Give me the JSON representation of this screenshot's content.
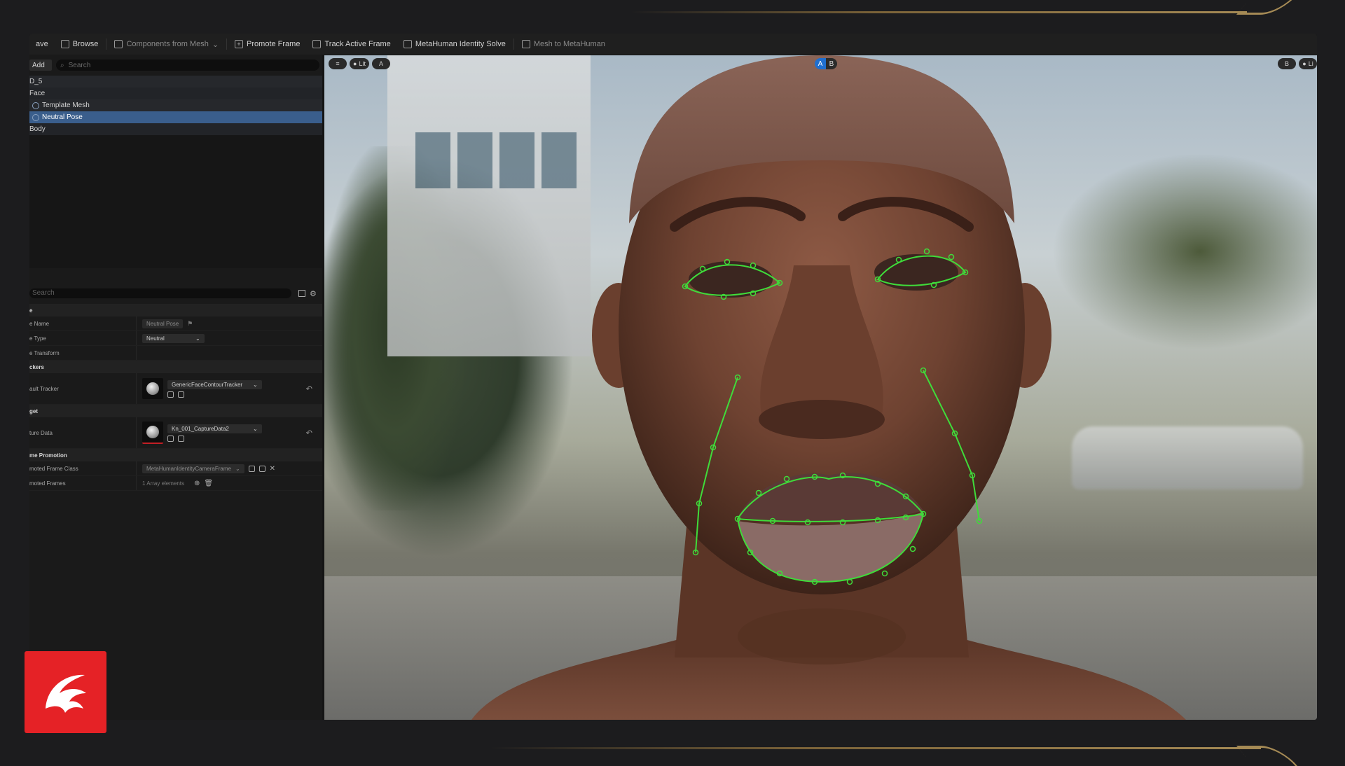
{
  "toolbar": {
    "save": "ave",
    "browse": "Browse",
    "components_from_mesh": "Components from Mesh",
    "promote_frame": "Promote Frame",
    "track_active_frame": "Track Active Frame",
    "metahuman_identity_solve": "MetaHuman Identity Solve",
    "mesh_to_metahuman": "Mesh to MetaHuman"
  },
  "outliner": {
    "add_label": "Add",
    "search_placeholder": "Search",
    "items": [
      {
        "label": "D_5"
      },
      {
        "label": "Face"
      },
      {
        "label": "Template Mesh"
      },
      {
        "label": "Neutral Pose"
      },
      {
        "label": "Body"
      }
    ]
  },
  "details": {
    "search_placeholder": "Search",
    "category_general": "e",
    "pose_name_label": "e Name",
    "pose_name_value": "Neutral Pose",
    "pose_type_label": "e Type",
    "pose_type_value": "Neutral",
    "pose_transform_label": "e Transform",
    "category_trackers": "ckers",
    "default_tracker_label": "ault Tracker",
    "default_tracker_value": "GenericFaceContourTracker",
    "category_target": "get",
    "capture_data_label": "ture Data",
    "capture_data_value": "Kn_001_CaptureData2",
    "category_frame_promotion": "me Promotion",
    "promoted_frame_class_label": "moted Frame Class",
    "promoted_frame_class_value": "MetaHumanIdentityCameraFrame",
    "promoted_frames_label": "moted Frames",
    "promoted_frames_value": "1 Array elements"
  },
  "viewport": {
    "lit_label": "Lit",
    "a_label": "A",
    "ab_a": "A",
    "ab_b": "B",
    "right_b": "B",
    "right_lit": "Li"
  },
  "colors": {
    "accent_blue": "#1f6fd0",
    "selection": "#3a5e8c",
    "tracker_green": "#3fdc3a",
    "logo_red": "#e52226"
  }
}
